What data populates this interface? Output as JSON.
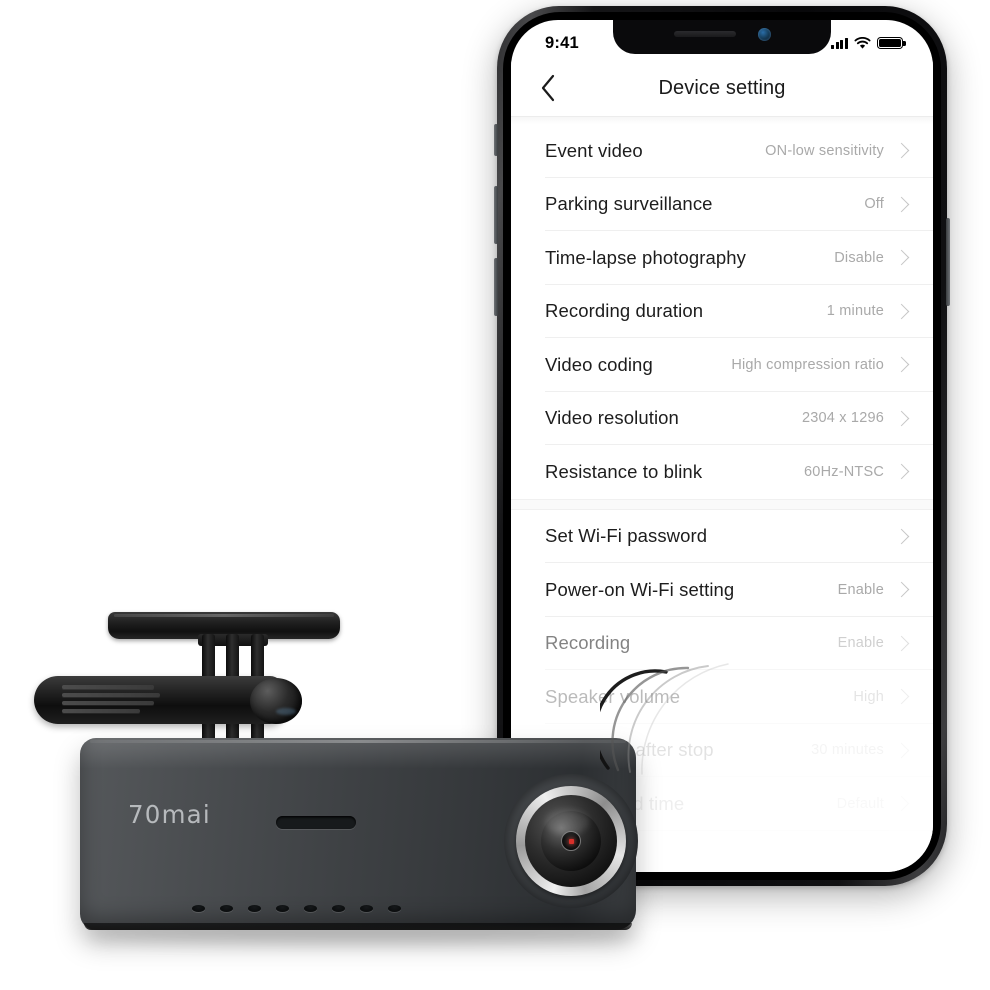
{
  "phone": {
    "status_bar": {
      "time": "9:41",
      "cellular_icon": "signal-bars-icon",
      "wifi_icon": "wifi-icon",
      "battery_icon": "battery-full-icon"
    },
    "nav": {
      "back_icon": "chevron-left-icon",
      "title": "Device setting"
    }
  },
  "settings": {
    "group1": [
      {
        "label": "Event video",
        "value": "ON-low sensitivity",
        "chevron": "chevron-right-icon",
        "fade": ""
      },
      {
        "label": "Parking surveillance",
        "value": "Off",
        "chevron": "chevron-right-icon",
        "fade": ""
      },
      {
        "label": "Time-lapse photography",
        "value": "Disable",
        "chevron": "chevron-right-icon",
        "fade": ""
      },
      {
        "label": "Recording duration",
        "value": "1 minute",
        "chevron": "chevron-right-icon",
        "fade": ""
      },
      {
        "label": "Video coding",
        "value": "High compression ratio",
        "chevron": "chevron-right-icon",
        "fade": ""
      },
      {
        "label": "Video resolution",
        "value": "2304 x 1296",
        "chevron": "chevron-right-icon",
        "fade": ""
      },
      {
        "label": "Resistance to blink",
        "value": "60Hz-NTSC",
        "chevron": "chevron-right-icon",
        "fade": ""
      }
    ],
    "group2": [
      {
        "label": "Set Wi-Fi password",
        "value": "",
        "chevron": "chevron-right-icon",
        "fade": ""
      },
      {
        "label": "Power-on Wi-Fi setting",
        "value": "Enable",
        "chevron": "chevron-right-icon",
        "fade": ""
      },
      {
        "label": "Recording",
        "value": "Enable",
        "chevron": "chevron-right-icon",
        "fade": "f1"
      },
      {
        "label": "Speaker volume",
        "value": "High",
        "chevron": "chevron-right-icon",
        "fade": "f2"
      },
      {
        "label": "Recording after stop",
        "value": "30 minutes",
        "chevron": "chevron-right-icon",
        "fade": "f3"
      },
      {
        "label": "Customised time",
        "value": "Default",
        "chevron": "chevron-right-icon",
        "fade": "f4"
      }
    ]
  },
  "device": {
    "brand_logo": "70mai",
    "parts": {
      "mount_plate": "adhesive-mount-plate",
      "mount_arms": "mount-arms",
      "rear_arm": "rear-vent-arm",
      "ball_joint": "ball-joint",
      "lens": "camera-lens",
      "lens_indicator": "red-indicator-dot",
      "mic_slot": "microphone-slot",
      "speaker_holes": "speaker-holes"
    }
  },
  "colors": {
    "screen_bg": "#ffffff",
    "label_text": "#1d1d1d",
    "value_text": "#a9a9a9",
    "separator": "#efefef",
    "phone_frame": "#0a0a0c",
    "device_body": "#3e4144",
    "logo_text": "#c6c9cc",
    "lens_dot": "#d9302a"
  }
}
